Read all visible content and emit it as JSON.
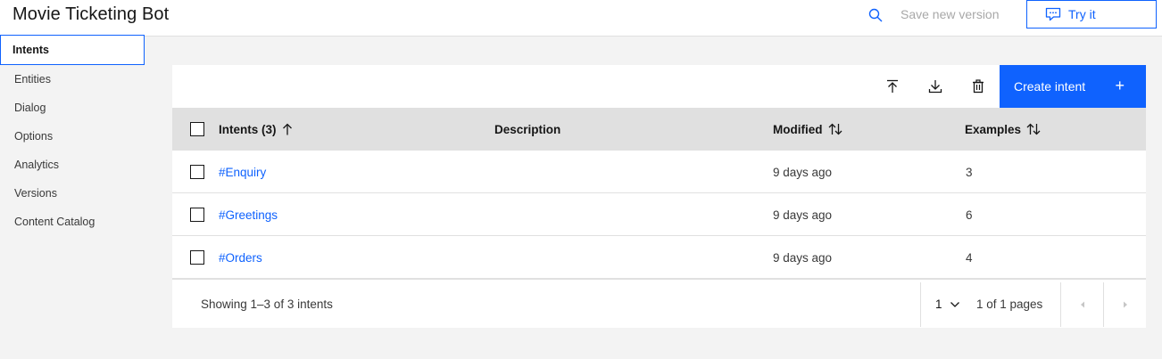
{
  "header": {
    "title": "Movie Ticketing Bot",
    "save_label": "Save new version",
    "try_label": "Try it"
  },
  "sidebar": {
    "items": [
      {
        "label": "Intents",
        "active": true
      },
      {
        "label": "Entities"
      },
      {
        "label": "Dialog"
      },
      {
        "label": "Options"
      },
      {
        "label": "Analytics"
      },
      {
        "label": "Versions"
      },
      {
        "label": "Content Catalog"
      }
    ]
  },
  "toolbar": {
    "create_label": "Create intent",
    "create_icon": "+"
  },
  "table": {
    "columns": {
      "intents": "Intents (3)",
      "description": "Description",
      "modified": "Modified",
      "examples": "Examples"
    },
    "rows": [
      {
        "name": "#Enquiry",
        "description": "",
        "modified": "9 days ago",
        "examples": "3"
      },
      {
        "name": "#Greetings",
        "description": "",
        "modified": "9 days ago",
        "examples": "6"
      },
      {
        "name": "#Orders",
        "description": "",
        "modified": "9 days ago",
        "examples": "4"
      }
    ]
  },
  "pagination": {
    "showing": "Showing 1–3 of 3 intents",
    "page": "1",
    "of_pages": "1 of 1 pages"
  },
  "colors": {
    "accent": "#0f62fe",
    "header_row": "#e0e0e0",
    "background": "#f3f3f3"
  }
}
